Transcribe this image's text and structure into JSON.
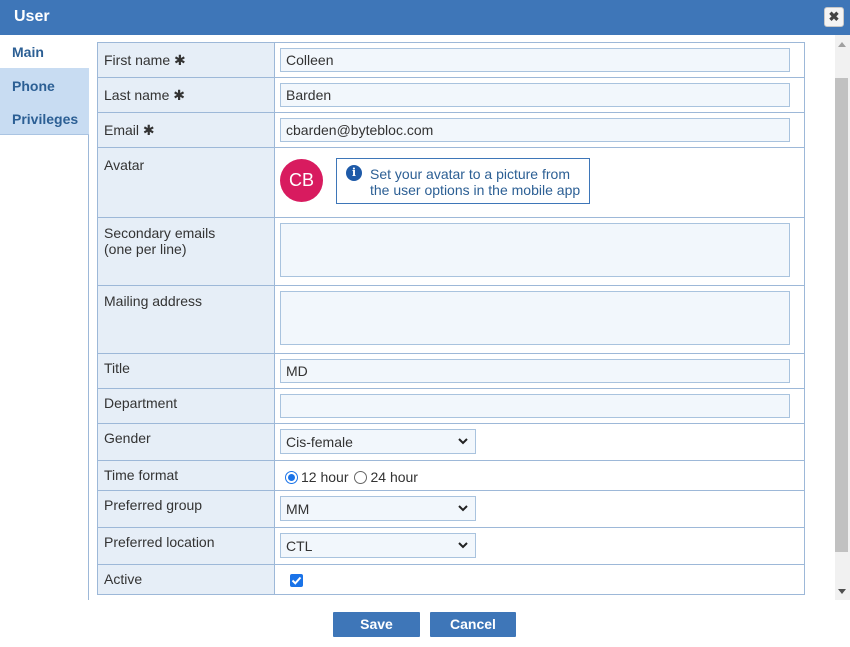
{
  "dialog": {
    "title": "User",
    "close_label": "✖"
  },
  "tabs": [
    {
      "label": "Main",
      "active": true
    },
    {
      "label": "Phone",
      "active": false
    },
    {
      "label": "Privileges",
      "active": false
    }
  ],
  "form": {
    "first_name": {
      "label": "First name ✱",
      "value": "Colleen"
    },
    "last_name": {
      "label": "Last name ✱",
      "value": "Barden"
    },
    "email": {
      "label": "Email ✱",
      "value": "cbarden@bytebloc.com"
    },
    "avatar": {
      "label": "Avatar",
      "initials": "CB",
      "info_line1": "Set your avatar to a picture from",
      "info_line2": "the user options in the mobile app",
      "color": "#d81b5f"
    },
    "secondary_emails": {
      "label_line1": "Secondary emails",
      "label_line2": "(one per line)",
      "value": ""
    },
    "mailing_address": {
      "label": "Mailing address",
      "value": ""
    },
    "title": {
      "label": "Title",
      "value": "MD"
    },
    "department": {
      "label": "Department",
      "value": ""
    },
    "gender": {
      "label": "Gender",
      "value": "Cis-female"
    },
    "time_format": {
      "label": "Time format",
      "option_12": "12 hour",
      "option_24": "24 hour",
      "selected": "12 hour"
    },
    "preferred_group": {
      "label": "Preferred group",
      "value": "MM"
    },
    "preferred_location": {
      "label": "Preferred location",
      "value": "CTL"
    },
    "active": {
      "label": "Active",
      "checked": true
    }
  },
  "footer": {
    "save_label": "Save",
    "cancel_label": "Cancel"
  },
  "colors": {
    "accent": "#3e76b8",
    "label_bg": "#e6eef7",
    "border": "#9db8d8",
    "input_bg": "#f2f7fc"
  }
}
